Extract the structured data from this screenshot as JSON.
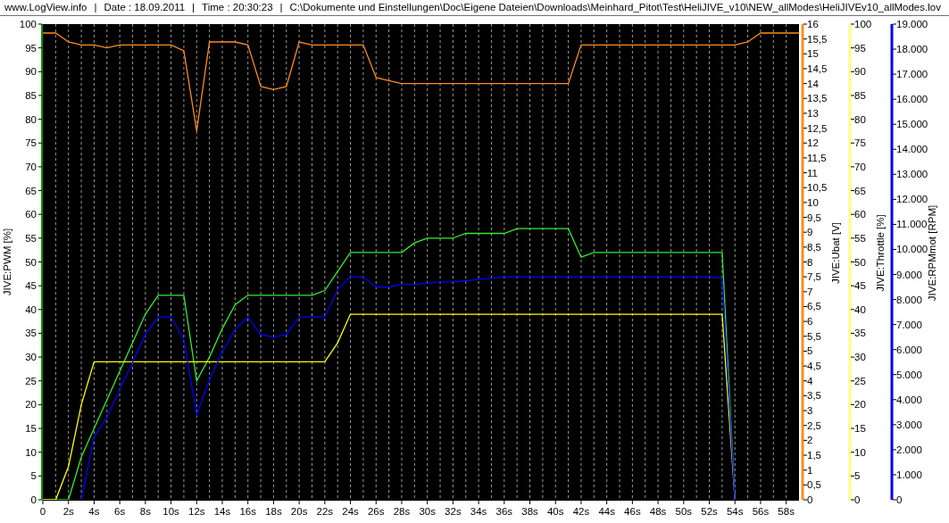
{
  "header": {
    "fields": [
      "www.LogView.info",
      "Date : 18.09.2011",
      "Time : 20:30:23",
      "C:\\Dokumente und Einstellungen\\Doc\\Eigene Dateien\\Downloads\\Meinhard_Pitot\\Test\\HeliJIVE_v10\\NEW_allModes\\HeliJIVEv10_allModes.lov"
    ],
    "separators": [
      "|",
      "|",
      "|"
    ]
  },
  "chart_data": {
    "type": "line",
    "grid": true,
    "ylabel": "JIVE:PWM [%]",
    "xlim": [
      0,
      59
    ],
    "ylim": [
      0,
      100
    ],
    "xticks": [
      {
        "value": 0,
        "label": "0"
      },
      {
        "value": 2,
        "label": "2s"
      },
      {
        "value": 4,
        "label": "4s"
      },
      {
        "value": 6,
        "label": "6s"
      },
      {
        "value": 8,
        "label": "8s"
      },
      {
        "value": 10,
        "label": "10s"
      },
      {
        "value": 12,
        "label": "12s"
      },
      {
        "value": 14,
        "label": "14s"
      },
      {
        "value": 16,
        "label": "16s"
      },
      {
        "value": 18,
        "label": "18s"
      },
      {
        "value": 20,
        "label": "20s"
      },
      {
        "value": 22,
        "label": "22s"
      },
      {
        "value": 24,
        "label": "24s"
      },
      {
        "value": 26,
        "label": "26s"
      },
      {
        "value": 28,
        "label": "28s"
      },
      {
        "value": 30,
        "label": "30s"
      },
      {
        "value": 32,
        "label": "32s"
      },
      {
        "value": 34,
        "label": "34s"
      },
      {
        "value": 36,
        "label": "36s"
      },
      {
        "value": 38,
        "label": "38s"
      },
      {
        "value": 40,
        "label": "40s"
      },
      {
        "value": 42,
        "label": "42s"
      },
      {
        "value": 44,
        "label": "44s"
      },
      {
        "value": 46,
        "label": "46s"
      },
      {
        "value": 48,
        "label": "48s"
      },
      {
        "value": 50,
        "label": "50s"
      },
      {
        "value": 52,
        "label": "52s"
      },
      {
        "value": 54,
        "label": "54s"
      },
      {
        "value": 56,
        "label": "56s"
      },
      {
        "value": 58,
        "label": "58s"
      }
    ],
    "yticks": [
      0,
      5,
      10,
      15,
      20,
      25,
      30,
      35,
      40,
      45,
      50,
      55,
      60,
      65,
      70,
      75,
      80,
      85,
      90,
      95,
      100
    ],
    "y3label": "JIVE:Ubat [V]",
    "y3lim": [
      0,
      16
    ],
    "y3ticks": [
      {
        "value": 0,
        "label": "0"
      },
      {
        "value": 0.5,
        "label": "0,5"
      },
      {
        "value": 1,
        "label": "1"
      },
      {
        "value": 1.5,
        "label": "1,5"
      },
      {
        "value": 2,
        "label": "2"
      },
      {
        "value": 2.5,
        "label": "2,5"
      },
      {
        "value": 3,
        "label": "3"
      },
      {
        "value": 3.5,
        "label": "3,5"
      },
      {
        "value": 4,
        "label": "4"
      },
      {
        "value": 4.5,
        "label": "4,5"
      },
      {
        "value": 5,
        "label": "5"
      },
      {
        "value": 5.5,
        "label": "5,5"
      },
      {
        "value": 6,
        "label": "6"
      },
      {
        "value": 6.5,
        "label": "6,5"
      },
      {
        "value": 7,
        "label": "7"
      },
      {
        "value": 7.5,
        "label": "7,5"
      },
      {
        "value": 8,
        "label": "8"
      },
      {
        "value": 8.5,
        "label": "8,5"
      },
      {
        "value": 9,
        "label": "9"
      },
      {
        "value": 9.5,
        "label": "9,5"
      },
      {
        "value": 10,
        "label": "10"
      },
      {
        "value": 10.5,
        "label": "10,5"
      },
      {
        "value": 11,
        "label": "11"
      },
      {
        "value": 11.5,
        "label": "11,5"
      },
      {
        "value": 12,
        "label": "12"
      },
      {
        "value": 12.5,
        "label": "12,5"
      },
      {
        "value": 13,
        "label": "13"
      },
      {
        "value": 13.5,
        "label": "13,5"
      },
      {
        "value": 14,
        "label": "14"
      },
      {
        "value": 14.5,
        "label": "14,5"
      },
      {
        "value": 15,
        "label": "15"
      },
      {
        "value": 15.5,
        "label": "15,5"
      },
      {
        "value": 16,
        "label": "16"
      }
    ],
    "y2label": "JIVE:RPMmot [RPM]",
    "y2lim": [
      0,
      19000
    ],
    "y2ticks": [
      {
        "value": 0,
        "label": "0"
      },
      {
        "value": 1000,
        "label": "1.000"
      },
      {
        "value": 2000,
        "label": "2.000"
      },
      {
        "value": 3000,
        "label": "3.000"
      },
      {
        "value": 4000,
        "label": "4.000"
      },
      {
        "value": 5000,
        "label": "5.000"
      },
      {
        "value": 6000,
        "label": "6.000"
      },
      {
        "value": 7000,
        "label": "7.000"
      },
      {
        "value": 8000,
        "label": "8.000"
      },
      {
        "value": 9000,
        "label": "9.000"
      },
      {
        "value": 10000,
        "label": "10.000"
      },
      {
        "value": 11000,
        "label": "11.000"
      },
      {
        "value": 12000,
        "label": "12.000"
      },
      {
        "value": 13000,
        "label": "13.000"
      },
      {
        "value": 14000,
        "label": "14.000"
      },
      {
        "value": 15000,
        "label": "15.000"
      },
      {
        "value": 16000,
        "label": "16.000"
      },
      {
        "value": 17000,
        "label": "17.000"
      },
      {
        "value": 18000,
        "label": "18.000"
      },
      {
        "value": 19000,
        "label": "19.000"
      }
    ],
    "x": [
      0,
      1,
      2,
      3,
      4,
      5,
      6,
      7,
      8,
      9,
      10,
      11,
      12,
      13,
      14,
      15,
      16,
      17,
      18,
      19,
      20,
      21,
      22,
      23,
      24,
      25,
      26,
      27,
      28,
      29,
      30,
      31,
      32,
      33,
      34,
      35,
      36,
      37,
      38,
      39,
      40,
      41,
      42,
      43,
      44,
      45,
      46,
      47,
      48,
      49,
      50,
      51,
      52,
      53,
      54,
      55,
      56,
      57,
      58,
      59
    ],
    "series": [
      {
        "color": "#33ee33",
        "values": [
          0,
          0,
          0,
          9,
          15,
          21,
          27,
          33,
          39,
          43,
          43,
          43,
          25,
          30,
          36,
          41,
          43,
          43,
          43,
          43,
          43,
          43,
          44,
          48,
          52,
          52,
          52,
          52,
          52,
          54,
          55,
          55,
          55,
          56,
          56,
          56,
          56,
          57,
          57,
          57,
          57,
          57,
          51,
          52,
          52,
          52,
          52,
          52,
          52,
          52,
          52,
          52,
          52,
          52,
          0,
          null,
          null,
          null,
          null,
          null
        ]
      },
      {
        "color": "#ff8c1a",
        "axis": "y3",
        "values": [
          15.7,
          15.7,
          15.4,
          15.3,
          15.3,
          15.2,
          15.3,
          15.3,
          15.3,
          15.3,
          15.3,
          15.1,
          12.4,
          15.4,
          15.4,
          15.4,
          15.3,
          13.9,
          13.8,
          13.9,
          15.4,
          15.3,
          15.3,
          15.3,
          15.3,
          15.3,
          14.2,
          14.1,
          14.0,
          14.0,
          14.0,
          14.0,
          14.0,
          14.0,
          14.0,
          14.0,
          14.0,
          14.0,
          14.0,
          14.0,
          14.0,
          14.0,
          15.3,
          15.3,
          15.3,
          15.3,
          15.3,
          15.3,
          15.3,
          15.3,
          15.3,
          15.3,
          15.3,
          15.3,
          15.3,
          15.4,
          15.7,
          15.7,
          15.7,
          15.7
        ]
      },
      {
        "color": "#ffff00",
        "values": [
          0,
          0,
          7,
          20,
          29,
          29,
          29,
          29,
          29,
          29,
          29,
          29,
          29,
          29,
          29,
          29,
          29,
          29,
          29,
          29,
          29,
          29,
          29,
          33,
          39,
          39,
          39,
          39,
          39,
          39,
          39,
          39,
          39,
          39,
          39,
          39,
          39,
          39,
          39,
          39,
          39,
          39,
          39,
          39,
          39,
          39,
          39,
          39,
          39,
          39,
          39,
          39,
          39,
          39,
          0,
          null,
          null,
          null,
          null,
          null
        ]
      },
      {
        "color": "#0000ff",
        "axis": "y2",
        "values": [
          null,
          null,
          null,
          0,
          2500,
          3300,
          4400,
          5500,
          6600,
          7300,
          7300,
          6400,
          3400,
          4800,
          5900,
          6800,
          7300,
          6600,
          6500,
          6600,
          7300,
          7300,
          7300,
          8400,
          8900,
          8900,
          8500,
          8500,
          8600,
          8600,
          8650,
          8700,
          8700,
          8750,
          8800,
          8850,
          8900,
          8900,
          8900,
          8900,
          8900,
          8900,
          8900,
          8900,
          8900,
          8900,
          8900,
          8900,
          8900,
          8900,
          8900,
          8900,
          8900,
          8850,
          0,
          null,
          null,
          null,
          null,
          null
        ]
      }
    ]
  },
  "throttle_axis": {
    "label": "JIVE:Throttle [%]",
    "ticks": [
      "100",
      "95",
      "90",
      "85",
      "80",
      "75",
      "70",
      "65",
      "60",
      "55",
      "50",
      "45",
      "40",
      "35",
      "30",
      "25",
      "20",
      "15",
      "10",
      "5",
      "0"
    ]
  }
}
